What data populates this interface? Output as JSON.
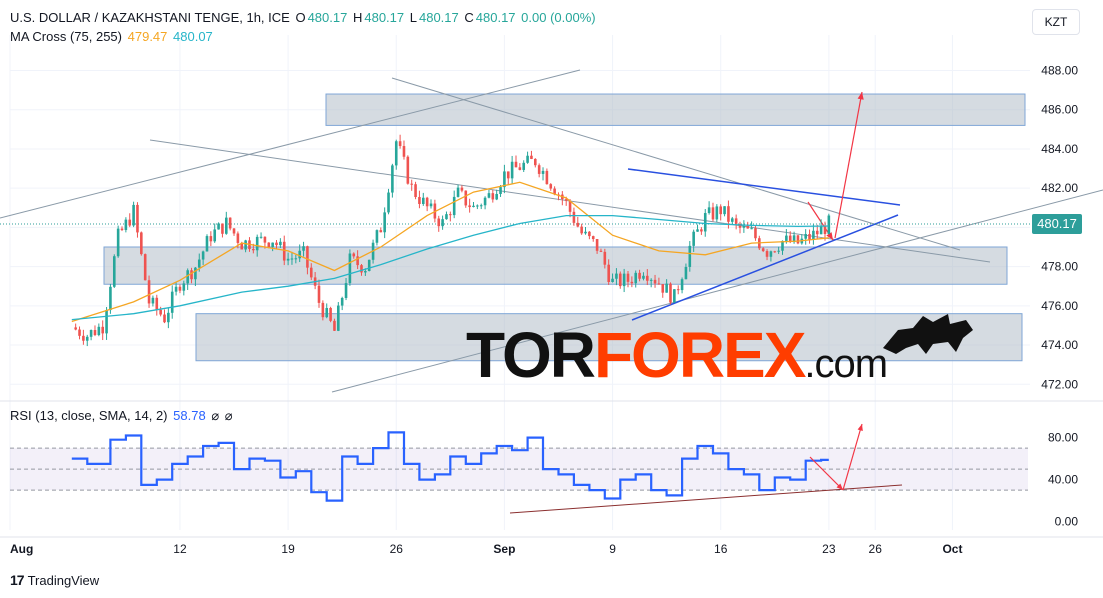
{
  "header": {
    "symbol": "U.S. DOLLAR / KAZAKHSTANI TENGE, 1h, ICE",
    "o_label": "O",
    "o": "480.17",
    "h_label": "H",
    "h": "480.17",
    "l_label": "L",
    "l": "480.17",
    "c_label": "C",
    "c": "480.17",
    "change": "0.00 (0.00%)",
    "ma_label": "MA Cross (75, 255)",
    "ma_fast": "479.47",
    "ma_slow": "480.07"
  },
  "currency": "KZT",
  "last_price": "480.17",
  "rsi_header": {
    "label": "RSI (13, close, SMA, 14, 2)",
    "value": "58.78",
    "sym1": "⌀",
    "sym2": "⌀"
  },
  "footer": {
    "brand": "TradingView",
    "logo": "17"
  },
  "watermark": {
    "part1": "TOR",
    "part2": "FOREX",
    "part3": ".com"
  },
  "colors": {
    "up": "#26a69a",
    "down": "#ef5350",
    "ma_fast": "#f5a623",
    "ma_slow": "#26b5c9",
    "rsi": "#2962ff",
    "zone": "#b2bec8",
    "trend_blue": "#2950e0",
    "arrow": "#f23645"
  },
  "chart_data": [
    {
      "type": "candlestick",
      "title": "U.S. DOLLAR / KAZAKHSTANI TENGE, 1h, ICE",
      "ylim": [
        471.3,
        489.3
      ],
      "y_ticks": [
        "488.00",
        "486.00",
        "484.00",
        "482.00",
        "480.00",
        "478.00",
        "476.00",
        "474.00",
        "472.00"
      ],
      "x_ticks": [
        "Aug",
        "12",
        "19",
        "26",
        "Sep",
        "9",
        "16",
        "23",
        "26",
        "Oct"
      ],
      "price_path": [
        [
          "Aug 5",
          474.9
        ],
        [
          "Aug 6",
          474.5
        ],
        [
          "Aug 7",
          475.0
        ],
        [
          "Aug 8",
          479.5
        ],
        [
          "Aug 9",
          480.8
        ],
        [
          "Aug 10",
          476.2
        ],
        [
          "Aug 11",
          475.4
        ],
        [
          "Aug 12",
          477.2
        ],
        [
          "Aug 13",
          478.0
        ],
        [
          "Aug 14",
          479.6
        ],
        [
          "Aug 15",
          480.2
        ],
        [
          "Aug 16",
          479.2
        ],
        [
          "Aug 17",
          479.3
        ],
        [
          "Aug 18",
          479.4
        ],
        [
          "Aug 19",
          478.4
        ],
        [
          "Aug 20",
          478.6
        ],
        [
          "Aug 21",
          476.2
        ],
        [
          "Aug 22",
          474.7
        ],
        [
          "Aug 23",
          478.3
        ],
        [
          "Aug 24",
          478.0
        ],
        [
          "Aug 25",
          480.0
        ],
        [
          "Aug 26",
          484.4
        ],
        [
          "Aug 27",
          482.0
        ],
        [
          "Aug 28",
          481.0
        ],
        [
          "Aug 29",
          480.2
        ],
        [
          "Aug 30",
          481.7
        ],
        [
          "Aug 31",
          481.0
        ],
        [
          "Sep 1",
          481.6
        ],
        [
          "Sep 2",
          482.7
        ],
        [
          "Sep 3",
          483.1
        ],
        [
          "Sep 4",
          483.4
        ],
        [
          "Sep 5",
          482.3
        ],
        [
          "Sep 6",
          481.2
        ],
        [
          "Sep 7",
          479.7
        ],
        [
          "Sep 8",
          479.0
        ],
        [
          "Sep 9",
          477.2
        ],
        [
          "Sep 10",
          477.3
        ],
        [
          "Sep 11",
          477.9
        ],
        [
          "Sep 12",
          477.2
        ],
        [
          "Sep 13",
          476.4
        ],
        [
          "Sep 14",
          479.0
        ],
        [
          "Sep 15",
          480.5
        ],
        [
          "Sep 16",
          480.9
        ],
        [
          "Sep 17",
          480.0
        ],
        [
          "Sep 18",
          479.7
        ],
        [
          "Sep 19",
          478.8
        ],
        [
          "Sep 20",
          479.3
        ],
        [
          "Sep 21",
          479.2
        ],
        [
          "Sep 22",
          479.6
        ],
        [
          "Sep 23",
          480.17
        ]
      ],
      "ma_fast": [
        [
          "Aug 5",
          475.2
        ],
        [
          "Aug 9",
          476.2
        ],
        [
          "Aug 12",
          477.3
        ],
        [
          "Aug 16",
          479.2
        ],
        [
          "Aug 19",
          478.8
        ],
        [
          "Aug 22",
          477.8
        ],
        [
          "Aug 25",
          479.0
        ],
        [
          "Aug 28",
          480.6
        ],
        [
          "Aug 31",
          481.8
        ],
        [
          "Sep 3",
          482.3
        ],
        [
          "Sep 6",
          481.5
        ],
        [
          "Sep 9",
          479.6
        ],
        [
          "Sep 12",
          478.8
        ],
        [
          "Sep 15",
          478.6
        ],
        [
          "Sep 18",
          479.2
        ],
        [
          "Sep 21",
          479.3
        ],
        [
          "Sep 23",
          479.47
        ]
      ],
      "ma_slow": [
        [
          "Aug 5",
          475.3
        ],
        [
          "Aug 9",
          475.6
        ],
        [
          "Aug 12",
          476.0
        ],
        [
          "Aug 16",
          476.7
        ],
        [
          "Aug 19",
          477.0
        ],
        [
          "Aug 22",
          477.4
        ],
        [
          "Aug 25",
          478.1
        ],
        [
          "Aug 28",
          478.9
        ],
        [
          "Aug 31",
          479.6
        ],
        [
          "Sep 3",
          480.2
        ],
        [
          "Sep 6",
          480.6
        ],
        [
          "Sep 9",
          480.6
        ],
        [
          "Sep 12",
          480.4
        ],
        [
          "Sep 15",
          480.2
        ],
        [
          "Sep 18",
          480.1
        ],
        [
          "Sep 21",
          480.05
        ],
        [
          "Sep 23",
          480.07
        ]
      ],
      "zones": [
        [
          485.2,
          486.8
        ],
        [
          477.1,
          479.0
        ],
        [
          473.2,
          475.6
        ]
      ]
    },
    {
      "type": "line",
      "title": "RSI (13, close, SMA, 14, 2)",
      "ylim": [
        -8,
        92
      ],
      "y_ticks": [
        "80.00",
        "40.00",
        "0.00"
      ],
      "bands": [
        30,
        70
      ],
      "last_value": 58.78,
      "values": [
        [
          "Aug 5",
          60
        ],
        [
          "Aug 7",
          55
        ],
        [
          "Aug 8",
          78
        ],
        [
          "Aug 9",
          82
        ],
        [
          "Aug 10",
          35
        ],
        [
          "Aug 11",
          40
        ],
        [
          "Aug 12",
          55
        ],
        [
          "Aug 13",
          62
        ],
        [
          "Aug 14",
          72
        ],
        [
          "Aug 15",
          75
        ],
        [
          "Aug 16",
          50
        ],
        [
          "Aug 17",
          60
        ],
        [
          "Aug 18",
          58
        ],
        [
          "Aug 19",
          42
        ],
        [
          "Aug 20",
          48
        ],
        [
          "Aug 21",
          28
        ],
        [
          "Aug 22",
          20
        ],
        [
          "Aug 23",
          62
        ],
        [
          "Aug 24",
          55
        ],
        [
          "Aug 25",
          70
        ],
        [
          "Aug 26",
          85
        ],
        [
          "Aug 27",
          55
        ],
        [
          "Aug 28",
          40
        ],
        [
          "Aug 29",
          45
        ],
        [
          "Aug 30",
          62
        ],
        [
          "Aug 31",
          55
        ],
        [
          "Sep 1",
          65
        ],
        [
          "Sep 2",
          72
        ],
        [
          "Sep 3",
          68
        ],
        [
          "Sep 4",
          80
        ],
        [
          "Sep 5",
          50
        ],
        [
          "Sep 6",
          45
        ],
        [
          "Sep 7",
          35
        ],
        [
          "Sep 8",
          30
        ],
        [
          "Sep 9",
          22
        ],
        [
          "Sep 10",
          40
        ],
        [
          "Sep 11",
          45
        ],
        [
          "Sep 12",
          30
        ],
        [
          "Sep 13",
          25
        ],
        [
          "Sep 14",
          60
        ],
        [
          "Sep 15",
          72
        ],
        [
          "Sep 16",
          65
        ],
        [
          "Sep 17",
          50
        ],
        [
          "Sep 18",
          45
        ],
        [
          "Sep 19",
          30
        ],
        [
          "Sep 20",
          42
        ],
        [
          "Sep 21",
          40
        ],
        [
          "Sep 22",
          58
        ],
        [
          "Sep 23",
          58.78
        ]
      ]
    }
  ]
}
